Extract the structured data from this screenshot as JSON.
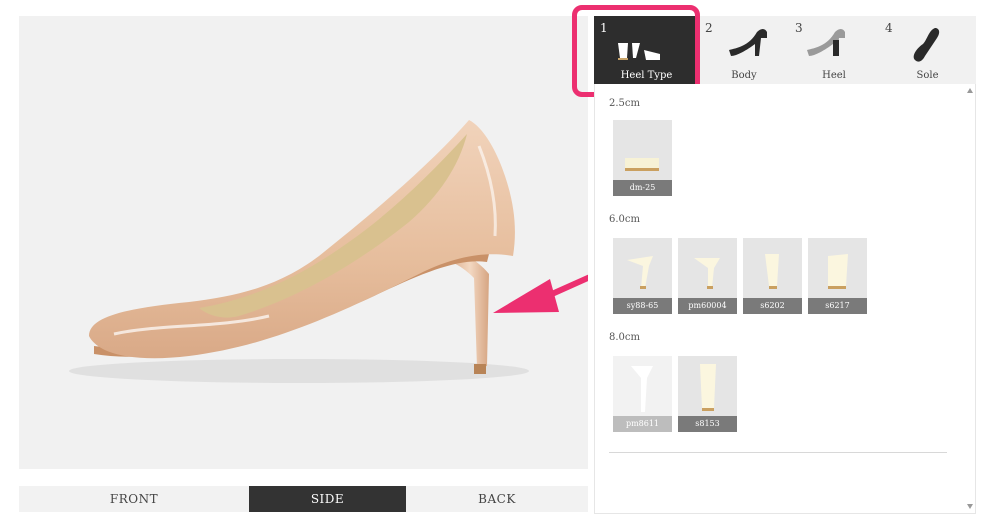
{
  "steps": [
    {
      "num": "1",
      "label": "Heel Type",
      "active": true
    },
    {
      "num": "2",
      "label": "Body",
      "active": false
    },
    {
      "num": "3",
      "label": "Heel",
      "active": false
    },
    {
      "num": "4",
      "label": "Sole",
      "active": false
    }
  ],
  "sections": [
    {
      "title": "2.5cm",
      "items": [
        {
          "code": "dm-25"
        }
      ]
    },
    {
      "title": "6.0cm",
      "items": [
        {
          "code": "sy88-65"
        },
        {
          "code": "pm60004"
        },
        {
          "code": "s6202"
        },
        {
          "code": "s6217"
        }
      ]
    },
    {
      "title": "8.0cm",
      "items": [
        {
          "code": "pm8611"
        },
        {
          "code": "s8153"
        }
      ]
    }
  ],
  "view_tabs": {
    "front": "FRONT",
    "side": "SIDE",
    "back": "BACK",
    "selected": "SIDE"
  },
  "colors": {
    "accent": "#ec2f70",
    "dark": "#2d2d2d",
    "shoe": "#e8c2a4"
  }
}
